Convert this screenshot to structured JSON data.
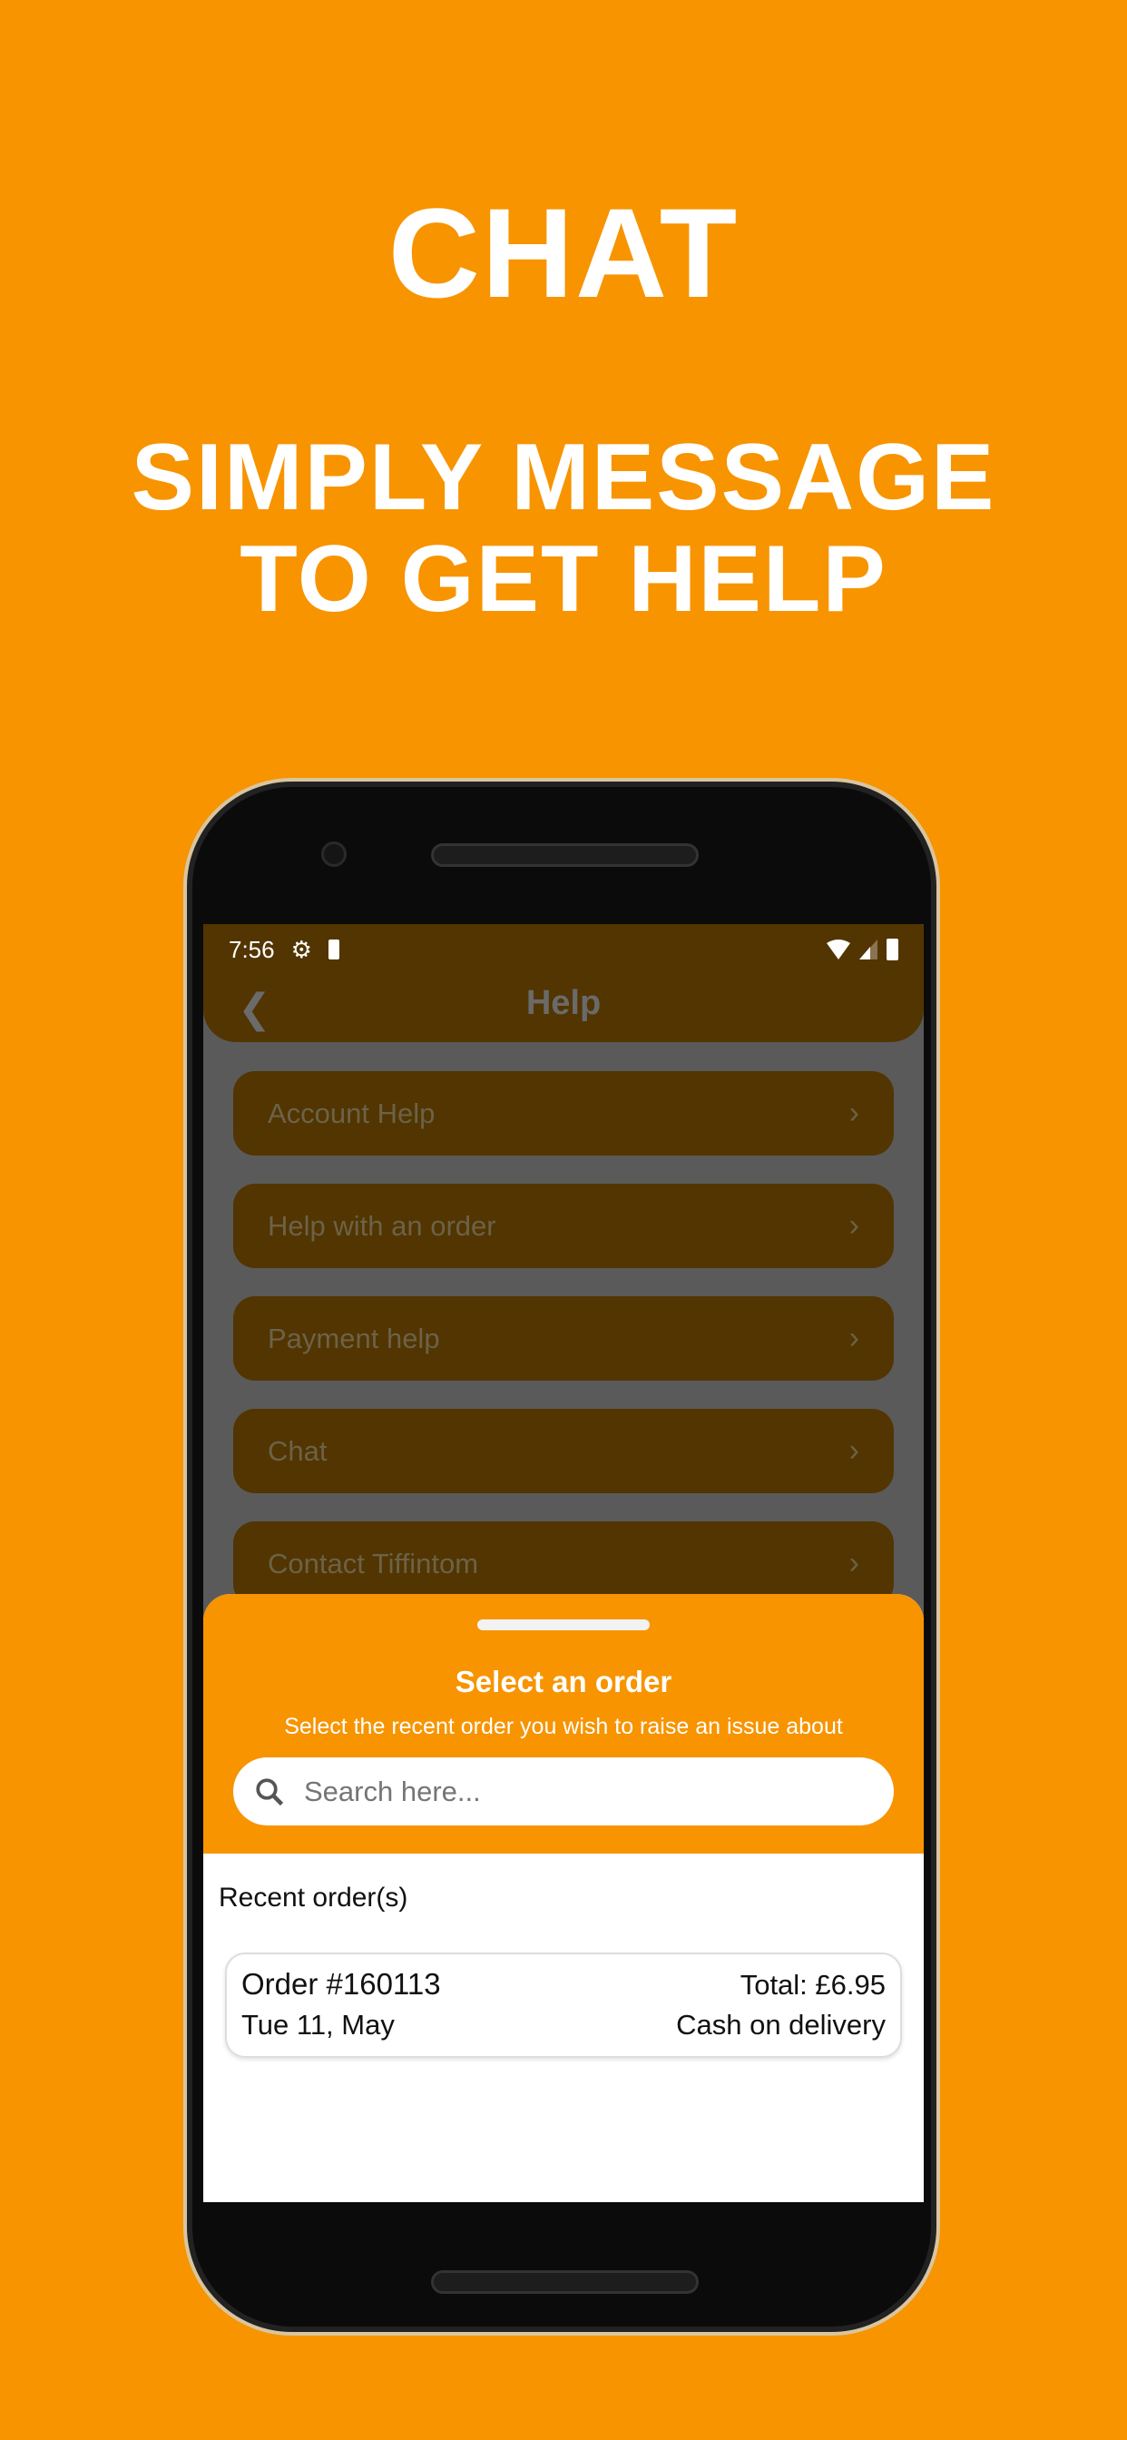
{
  "hero": {
    "title": "CHAT",
    "subtitle_line1": "SIMPLY MESSAGE",
    "subtitle_line2": "TO GET HELP"
  },
  "status_bar": {
    "time": "7:56",
    "icons": [
      "gear-icon",
      "battery-saver-icon",
      "wifi-icon",
      "signal-icon",
      "battery-icon"
    ]
  },
  "header": {
    "title": "Help",
    "back_icon": "chevron-left-icon"
  },
  "menu": [
    {
      "label": "Account Help"
    },
    {
      "label": "Help with an order"
    },
    {
      "label": "Payment help"
    },
    {
      "label": "Chat"
    },
    {
      "label": "Contact Tiffintom"
    }
  ],
  "sheet": {
    "title": "Select an order",
    "subtitle": "Select the recent order you wish to raise an issue about",
    "search_placeholder": "Search here...",
    "section_label": "Recent order(s)",
    "orders": [
      {
        "number": "Order #160113",
        "date": "Tue 11, May",
        "total": "Total: £6.95",
        "payment": "Cash on delivery"
      }
    ]
  },
  "colors": {
    "brand": "#f79400",
    "overlay_item": "#523500"
  }
}
